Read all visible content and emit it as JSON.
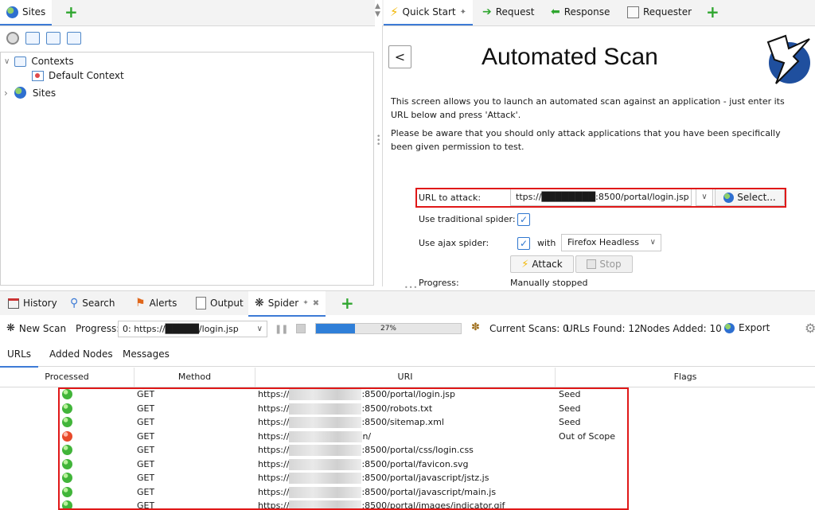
{
  "sites_panel": {
    "tab_label": "Sites",
    "tree": {
      "contexts_label": "Contexts",
      "default_context_label": "Default Context",
      "sites_label": "Sites"
    }
  },
  "workspace": {
    "tabs": [
      {
        "label": "Quick Start"
      },
      {
        "label": "Request"
      },
      {
        "label": "Response"
      },
      {
        "label": "Requester"
      }
    ]
  },
  "quick_start": {
    "back_label": "<",
    "title": "Automated Scan",
    "intro": "This screen allows you to launch an automated scan against  an application - just enter its URL below and press 'Attack'.",
    "warning": "Please be aware that you should only attack applications that you have been specifically been given permission to test.",
    "url_label": "URL to attack:",
    "url_value": "ttps://████████:8500/portal/login.jsp",
    "select_label": "Select...",
    "traditional_label": "Use traditional spider:",
    "ajax_label": "Use ajax spider:",
    "with_label": "with",
    "browser_value": "Firefox Headless",
    "attack_label": "Attack",
    "stop_label": "Stop",
    "progress_label": "Progress:",
    "progress_value": "Manually stopped"
  },
  "bottom_tabs": [
    {
      "label": "History"
    },
    {
      "label": "Search"
    },
    {
      "label": "Alerts"
    },
    {
      "label": "Output"
    },
    {
      "label": "Spider"
    }
  ],
  "spider_toolbar": {
    "new_scan_label": "New Scan",
    "progress_label": "Progress:",
    "scan_select_value": "0: https://█████/login.jsp",
    "progress_percent": "27%",
    "progress_fraction": 0.27,
    "current_scans": "Current Scans: 0",
    "urls_found": "URLs Found: 12",
    "nodes_added": "Nodes Added: 10",
    "export_label": "Export"
  },
  "sub_tabs": [
    {
      "label": "URLs"
    },
    {
      "label": "Added Nodes"
    },
    {
      "label": "Messages"
    }
  ],
  "table": {
    "headers": [
      "Processed",
      "Method",
      "URI",
      "Flags"
    ],
    "rows": [
      {
        "status": "green",
        "method": "GET",
        "uri_prefix": "https://",
        "uri_suffix": ":8500/portal/login.jsp",
        "flag": "Seed"
      },
      {
        "status": "green",
        "method": "GET",
        "uri_prefix": "https://",
        "uri_suffix": ":8500/robots.txt",
        "flag": "Seed"
      },
      {
        "status": "green",
        "method": "GET",
        "uri_prefix": "https://",
        "uri_suffix": ":8500/sitemap.xml",
        "flag": "Seed"
      },
      {
        "status": "red",
        "method": "GET",
        "uri_prefix": "https://",
        "uri_suffix": "n/",
        "flag": "Out of Scope"
      },
      {
        "status": "green",
        "method": "GET",
        "uri_prefix": "https://",
        "uri_suffix": ":8500/portal/css/login.css",
        "flag": ""
      },
      {
        "status": "green",
        "method": "GET",
        "uri_prefix": "https://",
        "uri_suffix": ":8500/portal/favicon.svg",
        "flag": ""
      },
      {
        "status": "green",
        "method": "GET",
        "uri_prefix": "https://",
        "uri_suffix": ":8500/portal/javascript/jstz.js",
        "flag": ""
      },
      {
        "status": "green",
        "method": "GET",
        "uri_prefix": "https://",
        "uri_suffix": ":8500/portal/javascript/main.js",
        "flag": ""
      },
      {
        "status": "green",
        "method": "GET",
        "uri_prefix": "https://",
        "uri_suffix": ":8500/portal/images/indicator.gif",
        "flag": ""
      }
    ]
  },
  "colors": {
    "accent": "#3d7bd6",
    "highlight_border": "#e01818",
    "status_green": "#41b53a",
    "status_red": "#e84a2a",
    "progress_fill": "#2f7fd8"
  }
}
